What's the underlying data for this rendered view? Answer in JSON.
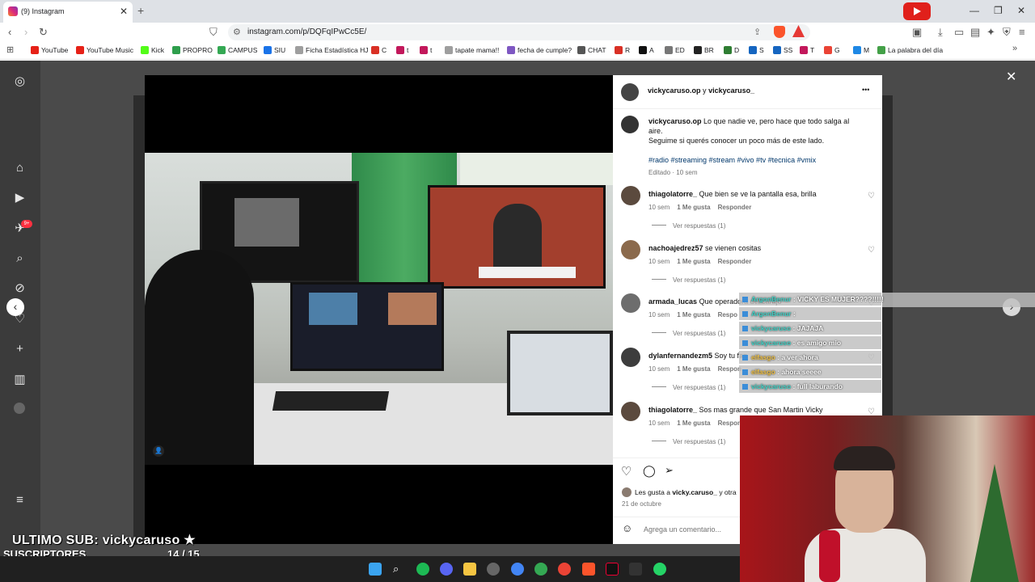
{
  "browser": {
    "tab_title": "(9) Instagram",
    "url": "instagram.com/p/DQFqIPwCc5E/",
    "new_tab": "+",
    "tab_close": "✕",
    "bookmarks": [
      {
        "label": "YouTube",
        "color": "#e62117"
      },
      {
        "label": "YouTube Music",
        "color": "#e62117"
      },
      {
        "label": "Kick",
        "color": "#53fc18"
      },
      {
        "label": "PROPRO",
        "color": "#2e9e4c"
      },
      {
        "label": "CAMPUS",
        "color": "#34a853"
      },
      {
        "label": "SIU",
        "color": "#1a73e8"
      },
      {
        "label": "Ficha Estadística HJ",
        "color": "#9e9e9e"
      },
      {
        "label": "C",
        "color": "#d93025"
      },
      {
        "label": "t",
        "color": "#c2185b"
      },
      {
        "label": "t",
        "color": "#c2185b"
      },
      {
        "label": "tapate mama!!",
        "color": "#9e9e9e"
      },
      {
        "label": "fecha de cumple?",
        "color": "#7e57c2"
      },
      {
        "label": "CHAT",
        "color": "#555555"
      },
      {
        "label": "R",
        "color": "#d93025"
      },
      {
        "label": "A",
        "color": "#111111"
      },
      {
        "label": "ED",
        "color": "#777777"
      },
      {
        "label": "BR",
        "color": "#222222"
      },
      {
        "label": "D",
        "color": "#2e7d32"
      },
      {
        "label": "S",
        "color": "#1565c0"
      },
      {
        "label": "SS",
        "color": "#1565c0"
      },
      {
        "label": "T",
        "color": "#c2185b"
      },
      {
        "label": "G",
        "color": "#ea4335"
      },
      {
        "label": "M",
        "color": "#1e88e5"
      },
      {
        "label": "La palabra del día",
        "color": "#43a047"
      }
    ]
  },
  "post": {
    "header_users": "vickycaruso.op",
    "header_and": "y",
    "header_user2": "vickycaruso_",
    "more": "•••",
    "caption_user": "vickycaruso.op",
    "caption_line1": "Lo que nadie ve, pero hace que todo salga al",
    "caption_line2": "aire.",
    "caption_line3": "Seguime si querés conocer un poco más de este lado.",
    "hashtags": "#radio #streaming #stream #vivo #tv #tecnica #vmix",
    "edited": "Editado · 10 sem",
    "comments": [
      {
        "user": "thiagolatorre_",
        "text": "Que bien se ve la pantalla esa, brilla",
        "time": "10 sem",
        "likes": "1 Me gusta",
        "reply": "Responder",
        "replies": "Ver respuestas (1)"
      },
      {
        "user": "nachoajedrez57",
        "text": "se vienen cositas",
        "time": "10 sem",
        "likes": "1 Me gusta",
        "reply": "Responder",
        "replies": "Ver respuestas (1)"
      },
      {
        "user": "armada_lucas",
        "text": "Que operadora del carajo",
        "time": "10 sem",
        "likes": "1 Me gusta",
        "reply": "Respo",
        "replies": "Ver respuestas (1)"
      },
      {
        "user": "dylanfernandezm5",
        "text": "Soy tu fan",
        "time": "10 sem",
        "likes": "1 Me gusta",
        "reply": "Respon",
        "replies": "Ver respuestas (1)"
      },
      {
        "user": "thiagolatorre_",
        "text": "Sos mas grande que San Martin Vicky",
        "time": "10 sem",
        "likes": "1 Me gusta",
        "reply": "Respon",
        "replies": "Ver respuestas (1)"
      }
    ],
    "liked_by_prefix": "Les gusta a",
    "liked_by_user": "vicky.caruso_",
    "liked_by_suffix": "y otra",
    "date": "21 de octubre",
    "add_comment_placeholder": "Agrega un comentario..."
  },
  "chat": [
    {
      "user": "ArgonBenur",
      "msg": "VICKY ES MUJER????!!!!!"
    },
    {
      "user": "ArgonBenur",
      "msg": ""
    },
    {
      "user": "vickycaruso",
      "msg": "JAJAJA"
    },
    {
      "user": "vickycaruso",
      "msg": "es amigo mio"
    },
    {
      "user": "elfasgo",
      "msg": "a ver ahora"
    },
    {
      "user": "elfasgo",
      "msg": "ahora seeee"
    },
    {
      "user": "vickycaruso",
      "msg": "full laburando"
    }
  ],
  "stream": {
    "last_sub_label": "ULTIMO SUB: vickycaruso",
    "star": "★",
    "subs_label": "SUSCRIPTORES",
    "subs_count": "14   / 15",
    "subs_progress": 0.93
  },
  "ig_nav": {
    "notif_badge": "9+"
  },
  "close": "✕"
}
